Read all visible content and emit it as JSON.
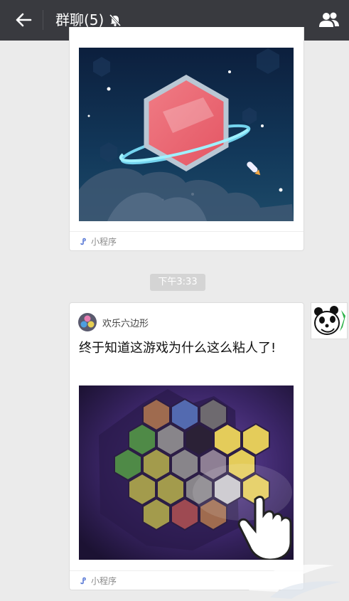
{
  "header": {
    "title": "群聊(5)",
    "back_icon": "arrow-left-icon",
    "mute_icon": "bell-off-icon",
    "group_icon": "group-members-icon",
    "bg_color": "#393a3f"
  },
  "messages": [
    {
      "type": "mini-program-card",
      "image_icon": "hexagon-planet-game-art",
      "footer_label": "小程序",
      "footer_icon": "mini-program-icon"
    },
    {
      "type": "timestamp",
      "text": "下午3:33"
    },
    {
      "type": "mini-program-card",
      "app_name": "欢乐六边形",
      "app_icon": "hexagon-game-app-icon",
      "title": "终于知道这游戏为什么这么粘人了!",
      "image_icon": "hexagon-puzzle-game-art",
      "footer_label": "小程序",
      "footer_icon": "mini-program-icon",
      "sender_avatar": "panda-avatar"
    }
  ],
  "colors": {
    "page_bg": "#ebebeb",
    "card_bg": "#ffffff",
    "time_badge": "#d4d4d4"
  }
}
